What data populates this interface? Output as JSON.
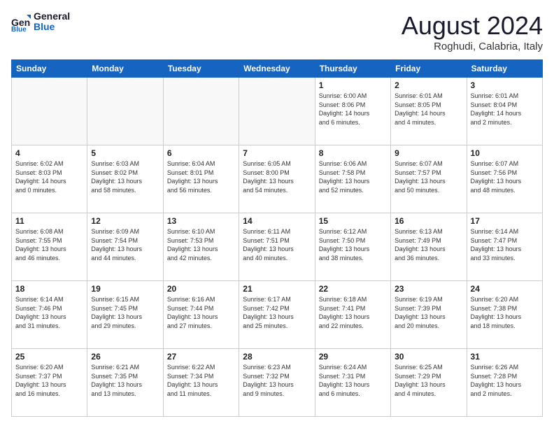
{
  "logo": {
    "line1": "General",
    "line2": "Blue"
  },
  "title": "August 2024",
  "location": "Roghudi, Calabria, Italy",
  "days_of_week": [
    "Sunday",
    "Monday",
    "Tuesday",
    "Wednesday",
    "Thursday",
    "Friday",
    "Saturday"
  ],
  "weeks": [
    [
      {
        "day": "",
        "info": ""
      },
      {
        "day": "",
        "info": ""
      },
      {
        "day": "",
        "info": ""
      },
      {
        "day": "",
        "info": ""
      },
      {
        "day": "1",
        "info": "Sunrise: 6:00 AM\nSunset: 8:06 PM\nDaylight: 14 hours\nand 6 minutes."
      },
      {
        "day": "2",
        "info": "Sunrise: 6:01 AM\nSunset: 8:05 PM\nDaylight: 14 hours\nand 4 minutes."
      },
      {
        "day": "3",
        "info": "Sunrise: 6:01 AM\nSunset: 8:04 PM\nDaylight: 14 hours\nand 2 minutes."
      }
    ],
    [
      {
        "day": "4",
        "info": "Sunrise: 6:02 AM\nSunset: 8:03 PM\nDaylight: 14 hours\nand 0 minutes."
      },
      {
        "day": "5",
        "info": "Sunrise: 6:03 AM\nSunset: 8:02 PM\nDaylight: 13 hours\nand 58 minutes."
      },
      {
        "day": "6",
        "info": "Sunrise: 6:04 AM\nSunset: 8:01 PM\nDaylight: 13 hours\nand 56 minutes."
      },
      {
        "day": "7",
        "info": "Sunrise: 6:05 AM\nSunset: 8:00 PM\nDaylight: 13 hours\nand 54 minutes."
      },
      {
        "day": "8",
        "info": "Sunrise: 6:06 AM\nSunset: 7:58 PM\nDaylight: 13 hours\nand 52 minutes."
      },
      {
        "day": "9",
        "info": "Sunrise: 6:07 AM\nSunset: 7:57 PM\nDaylight: 13 hours\nand 50 minutes."
      },
      {
        "day": "10",
        "info": "Sunrise: 6:07 AM\nSunset: 7:56 PM\nDaylight: 13 hours\nand 48 minutes."
      }
    ],
    [
      {
        "day": "11",
        "info": "Sunrise: 6:08 AM\nSunset: 7:55 PM\nDaylight: 13 hours\nand 46 minutes."
      },
      {
        "day": "12",
        "info": "Sunrise: 6:09 AM\nSunset: 7:54 PM\nDaylight: 13 hours\nand 44 minutes."
      },
      {
        "day": "13",
        "info": "Sunrise: 6:10 AM\nSunset: 7:53 PM\nDaylight: 13 hours\nand 42 minutes."
      },
      {
        "day": "14",
        "info": "Sunrise: 6:11 AM\nSunset: 7:51 PM\nDaylight: 13 hours\nand 40 minutes."
      },
      {
        "day": "15",
        "info": "Sunrise: 6:12 AM\nSunset: 7:50 PM\nDaylight: 13 hours\nand 38 minutes."
      },
      {
        "day": "16",
        "info": "Sunrise: 6:13 AM\nSunset: 7:49 PM\nDaylight: 13 hours\nand 36 minutes."
      },
      {
        "day": "17",
        "info": "Sunrise: 6:14 AM\nSunset: 7:47 PM\nDaylight: 13 hours\nand 33 minutes."
      }
    ],
    [
      {
        "day": "18",
        "info": "Sunrise: 6:14 AM\nSunset: 7:46 PM\nDaylight: 13 hours\nand 31 minutes."
      },
      {
        "day": "19",
        "info": "Sunrise: 6:15 AM\nSunset: 7:45 PM\nDaylight: 13 hours\nand 29 minutes."
      },
      {
        "day": "20",
        "info": "Sunrise: 6:16 AM\nSunset: 7:44 PM\nDaylight: 13 hours\nand 27 minutes."
      },
      {
        "day": "21",
        "info": "Sunrise: 6:17 AM\nSunset: 7:42 PM\nDaylight: 13 hours\nand 25 minutes."
      },
      {
        "day": "22",
        "info": "Sunrise: 6:18 AM\nSunset: 7:41 PM\nDaylight: 13 hours\nand 22 minutes."
      },
      {
        "day": "23",
        "info": "Sunrise: 6:19 AM\nSunset: 7:39 PM\nDaylight: 13 hours\nand 20 minutes."
      },
      {
        "day": "24",
        "info": "Sunrise: 6:20 AM\nSunset: 7:38 PM\nDaylight: 13 hours\nand 18 minutes."
      }
    ],
    [
      {
        "day": "25",
        "info": "Sunrise: 6:20 AM\nSunset: 7:37 PM\nDaylight: 13 hours\nand 16 minutes."
      },
      {
        "day": "26",
        "info": "Sunrise: 6:21 AM\nSunset: 7:35 PM\nDaylight: 13 hours\nand 13 minutes."
      },
      {
        "day": "27",
        "info": "Sunrise: 6:22 AM\nSunset: 7:34 PM\nDaylight: 13 hours\nand 11 minutes."
      },
      {
        "day": "28",
        "info": "Sunrise: 6:23 AM\nSunset: 7:32 PM\nDaylight: 13 hours\nand 9 minutes."
      },
      {
        "day": "29",
        "info": "Sunrise: 6:24 AM\nSunset: 7:31 PM\nDaylight: 13 hours\nand 6 minutes."
      },
      {
        "day": "30",
        "info": "Sunrise: 6:25 AM\nSunset: 7:29 PM\nDaylight: 13 hours\nand 4 minutes."
      },
      {
        "day": "31",
        "info": "Sunrise: 6:26 AM\nSunset: 7:28 PM\nDaylight: 13 hours\nand 2 minutes."
      }
    ]
  ]
}
